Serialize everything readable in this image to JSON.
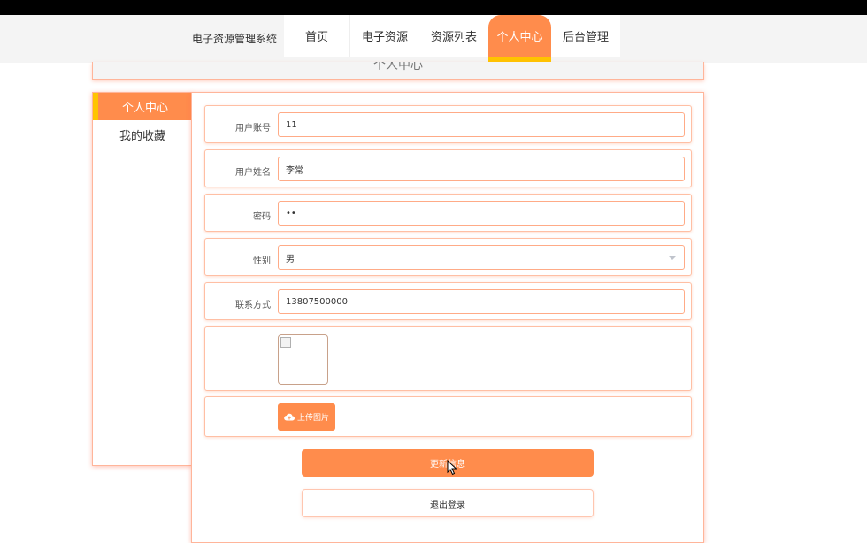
{
  "header": {
    "site_title": "电子资源管理系统",
    "nav": [
      "首页",
      "电子资源",
      "资源列表",
      "个人中心",
      "后台管理"
    ],
    "active_nav": "个人中心"
  },
  "banner": {
    "title": "个人中心"
  },
  "sidebar": {
    "items": [
      "个人中心",
      "我的收藏"
    ],
    "active": "个人中心"
  },
  "form": {
    "account": {
      "label": "用户账号",
      "value": "11"
    },
    "name": {
      "label": "用户姓名",
      "value": "李常"
    },
    "password": {
      "label": "密码",
      "value": "••"
    },
    "gender": {
      "label": "性别",
      "value": "男"
    },
    "phone": {
      "label": "联系方式",
      "value": "13807500000"
    },
    "upload_label": "上传图片"
  },
  "buttons": {
    "update": "更新信息",
    "logout": "退出登录"
  },
  "colors": {
    "accent": "#ff8c4c",
    "accent_secondary": "#ffc400"
  },
  "icons": {
    "upload": "cloud-upload-icon",
    "broken_image": "broken-image-icon",
    "select": "chevron-down-icon",
    "cursor": "mouse-pointer-icon"
  }
}
